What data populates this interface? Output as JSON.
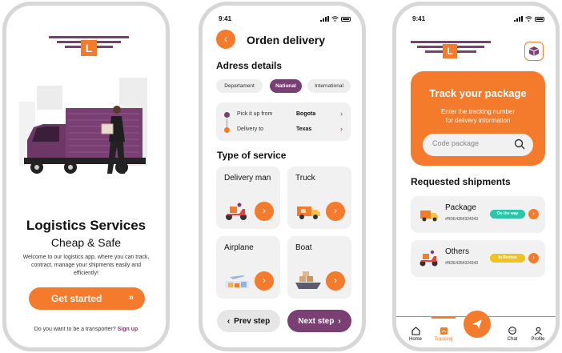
{
  "colors": {
    "primary_purple": "#7a3f73",
    "accent_orange": "#f47a2c",
    "on_the_way": "#2bc5a7",
    "in_review": "#f2c31b"
  },
  "onboarding": {
    "logo_letter": "L",
    "title": "Logistics Services",
    "subtitle": "Cheap & Safe",
    "description": "Welcome to our logistics app, where you can track, contract, manage your shipments easily and efficiently!",
    "cta_label": "Get started",
    "cta_icon": "double-chevron-right-icon",
    "transporter_prompt": "Do you want to be a transporter?",
    "signup_link": "Sign up"
  },
  "order": {
    "status_time": "9:41",
    "back_icon": "chevron-left-icon",
    "title": "Orden delivery",
    "address_heading": "Adress details",
    "scope_tabs": [
      {
        "label": "Departament",
        "selected": false
      },
      {
        "label": "National",
        "selected": true
      },
      {
        "label": "International",
        "selected": false
      }
    ],
    "pickup_label": "Pick it up from",
    "pickup_value": "Bogota",
    "delivery_label": "Delivery to",
    "delivery_value": "Texas",
    "service_heading": "Type of service",
    "services": [
      {
        "label": "Delivery man",
        "icon": "scooter-icon"
      },
      {
        "label": "Truck",
        "icon": "truck-icon"
      },
      {
        "label": "Airplane",
        "icon": "airplane-icon"
      },
      {
        "label": "Boat",
        "icon": "boat-icon"
      }
    ],
    "prev_label": "Prev step",
    "next_label": "Next step"
  },
  "tracking": {
    "status_time": "9:41",
    "logo_letter": "L",
    "package_icon": "box-icon",
    "track_title": "Track your package",
    "track_subtitle_1": "Enter the tracking number",
    "track_subtitle_2": "for delivery information",
    "search_placeholder": "Code package",
    "shipments_heading": "Requested shipments",
    "shipments": [
      {
        "name": "Package",
        "code": "#RDE4354324343",
        "status": "On the way",
        "icon": "truck-icon"
      },
      {
        "name": "Others",
        "code": "#RDE4354324343",
        "status": "In Review",
        "icon": "scooter-icon"
      }
    ],
    "nav": [
      {
        "label": "Home",
        "icon": "home-icon",
        "active": false
      },
      {
        "label": "Tracking",
        "icon": "tracking-icon",
        "active": true
      },
      {
        "label": "Chat",
        "icon": "chat-icon",
        "active": false
      },
      {
        "label": "Profile",
        "icon": "profile-icon",
        "active": false
      }
    ],
    "fab_icon": "send-icon"
  }
}
